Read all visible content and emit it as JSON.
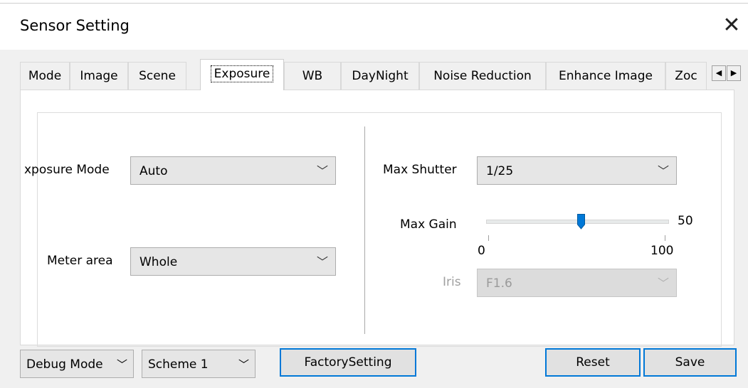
{
  "window": {
    "title": "Sensor Setting",
    "close_glyph": "✕"
  },
  "tabs": [
    "Mode",
    "Image",
    "Scene",
    "Exposure",
    "WB",
    "DayNight",
    "Noise Reduction",
    "Enhance Image",
    "Zoc"
  ],
  "active_tab": "Exposure",
  "tab_scroll": {
    "left": "◀",
    "right": "▶"
  },
  "exposure": {
    "exposure_mode": {
      "label": "xposure Mode",
      "value": "Auto"
    },
    "meter_area": {
      "label": "Meter area",
      "value": "Whole"
    },
    "max_shutter": {
      "label": "Max Shutter",
      "value": "1/25"
    },
    "max_gain": {
      "label": "Max Gain",
      "value": "50",
      "min": "0",
      "max": "100",
      "level": 50
    },
    "iris": {
      "label": "Iris",
      "value": "F1.6",
      "disabled": true
    }
  },
  "footer": {
    "debug_mode": "Debug Mode",
    "scheme": "Scheme 1",
    "factory_setting": "FactorySetting",
    "reset": "Reset",
    "save": "Save"
  },
  "colors": {
    "accent": "#0078d7",
    "window_bg": "#f0f0f0",
    "panel_bg": "#ffffff"
  }
}
